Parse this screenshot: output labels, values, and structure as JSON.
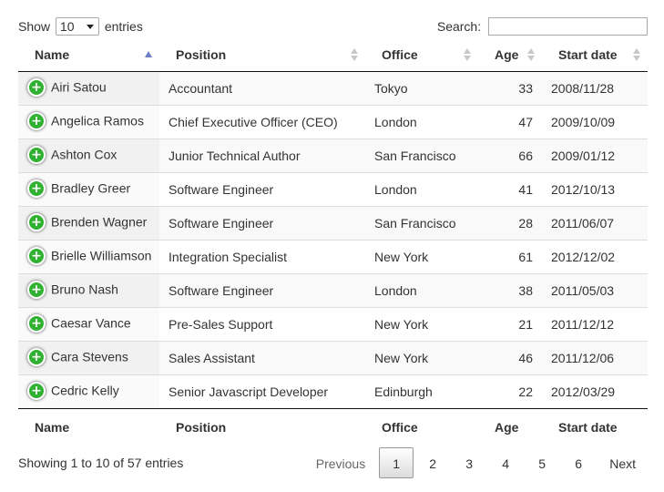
{
  "controls": {
    "show_label": "Show",
    "entries_label": "entries",
    "length_value": "10",
    "search_label": "Search:",
    "search_value": ""
  },
  "columns": [
    "Name",
    "Position",
    "Office",
    "Age",
    "Start date"
  ],
  "sort": {
    "column": "Name",
    "direction": "ascending"
  },
  "rows": [
    {
      "name": "Airi Satou",
      "position": "Accountant",
      "office": "Tokyo",
      "age": "33",
      "start": "2008/11/28"
    },
    {
      "name": "Angelica Ramos",
      "position": "Chief Executive Officer (CEO)",
      "office": "London",
      "age": "47",
      "start": "2009/10/09"
    },
    {
      "name": "Ashton Cox",
      "position": "Junior Technical Author",
      "office": "San Francisco",
      "age": "66",
      "start": "2009/01/12"
    },
    {
      "name": "Bradley Greer",
      "position": "Software Engineer",
      "office": "London",
      "age": "41",
      "start": "2012/10/13"
    },
    {
      "name": "Brenden Wagner",
      "position": "Software Engineer",
      "office": "San Francisco",
      "age": "28",
      "start": "2011/06/07"
    },
    {
      "name": "Brielle Williamson",
      "position": "Integration Specialist",
      "office": "New York",
      "age": "61",
      "start": "2012/12/02"
    },
    {
      "name": "Bruno Nash",
      "position": "Software Engineer",
      "office": "London",
      "age": "38",
      "start": "2011/05/03"
    },
    {
      "name": "Caesar Vance",
      "position": "Pre-Sales Support",
      "office": "New York",
      "age": "21",
      "start": "2011/12/12"
    },
    {
      "name": "Cara Stevens",
      "position": "Sales Assistant",
      "office": "New York",
      "age": "46",
      "start": "2011/12/06"
    },
    {
      "name": "Cedric Kelly",
      "position": "Senior Javascript Developer",
      "office": "Edinburgh",
      "age": "22",
      "start": "2012/03/29"
    }
  ],
  "expand_icon": "plus-circle-icon",
  "info": "Showing 1 to 10 of 57 entries",
  "pagination": {
    "previous": "Previous",
    "next": "Next",
    "pages": [
      "1",
      "2",
      "3",
      "4",
      "5",
      "6"
    ],
    "current": "1"
  },
  "colors": {
    "expand_button": "#31b131",
    "sort_active": "#6b7fc8",
    "row_odd": "#f9f9f9"
  }
}
